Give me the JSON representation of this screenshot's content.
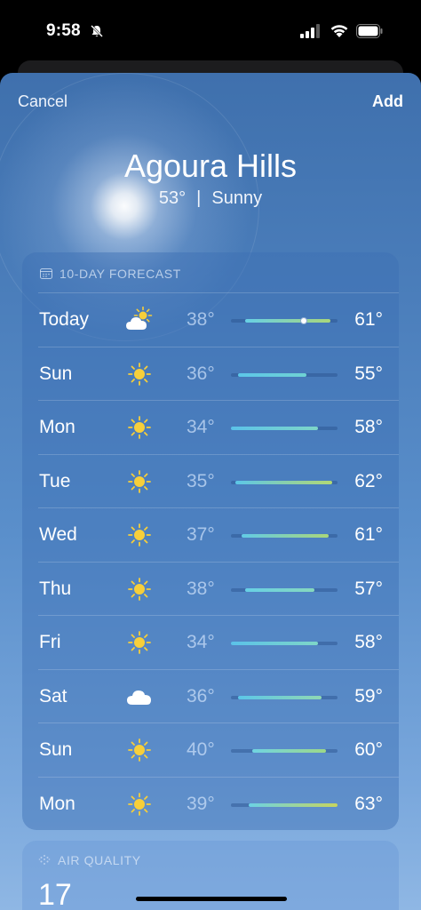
{
  "status_bar": {
    "time": "9:58"
  },
  "sheet": {
    "cancel_label": "Cancel",
    "add_label": "Add",
    "city": "Agoura Hills",
    "current_temp": "53°",
    "condition": "Sunny",
    "separator": "|"
  },
  "forecast": {
    "title": "10-DAY FORECAST",
    "days": [
      {
        "day": "Today",
        "icon": "partly-cloudy-sun-icon",
        "low": "38°",
        "high": "61°",
        "range_start": 0.13,
        "range_end": 0.93,
        "current_marker": 0.68,
        "colors": [
          "#67d0e6",
          "#a9d67a"
        ]
      },
      {
        "day": "Sun",
        "icon": "sun-icon",
        "low": "36°",
        "high": "55°",
        "range_start": 0.07,
        "range_end": 0.71,
        "colors": [
          "#5cc6e8",
          "#6fd2d3"
        ]
      },
      {
        "day": "Mon",
        "icon": "sun-icon",
        "low": "34°",
        "high": "58°",
        "range_start": 0.0,
        "range_end": 0.82,
        "colors": [
          "#5bc2e9",
          "#7ed6c8"
        ]
      },
      {
        "day": "Tue",
        "icon": "sun-icon",
        "low": "35°",
        "high": "62°",
        "range_start": 0.04,
        "range_end": 0.95,
        "colors": [
          "#5cc6e8",
          "#b2d874"
        ]
      },
      {
        "day": "Wed",
        "icon": "sun-icon",
        "low": "37°",
        "high": "61°",
        "range_start": 0.1,
        "range_end": 0.92,
        "colors": [
          "#62cbe6",
          "#a9d67a"
        ]
      },
      {
        "day": "Thu",
        "icon": "sun-icon",
        "low": "38°",
        "high": "57°",
        "range_start": 0.13,
        "range_end": 0.78,
        "colors": [
          "#67d0e6",
          "#86d8bd"
        ]
      },
      {
        "day": "Fri",
        "icon": "sun-icon",
        "low": "34°",
        "high": "58°",
        "range_start": 0.0,
        "range_end": 0.82,
        "colors": [
          "#5bc2e9",
          "#7ed6c8"
        ]
      },
      {
        "day": "Sat",
        "icon": "cloud-icon",
        "low": "36°",
        "high": "59°",
        "range_start": 0.07,
        "range_end": 0.85,
        "colors": [
          "#5cc6e8",
          "#8fd8b3"
        ]
      },
      {
        "day": "Sun",
        "icon": "sun-icon",
        "low": "40°",
        "high": "60°",
        "range_start": 0.2,
        "range_end": 0.89,
        "colors": [
          "#70d4e2",
          "#9dd888"
        ]
      },
      {
        "day": "Mon",
        "icon": "sun-icon",
        "low": "39°",
        "high": "63°",
        "range_start": 0.17,
        "range_end": 1.0,
        "colors": [
          "#6bd2e4",
          "#c7d55f"
        ]
      }
    ]
  },
  "air_quality": {
    "title": "AIR QUALITY",
    "value": "17"
  },
  "colors": {
    "sun": "#f7cf3a",
    "background_top": "#3f70ad",
    "background_bottom": "#8fb7e4"
  }
}
